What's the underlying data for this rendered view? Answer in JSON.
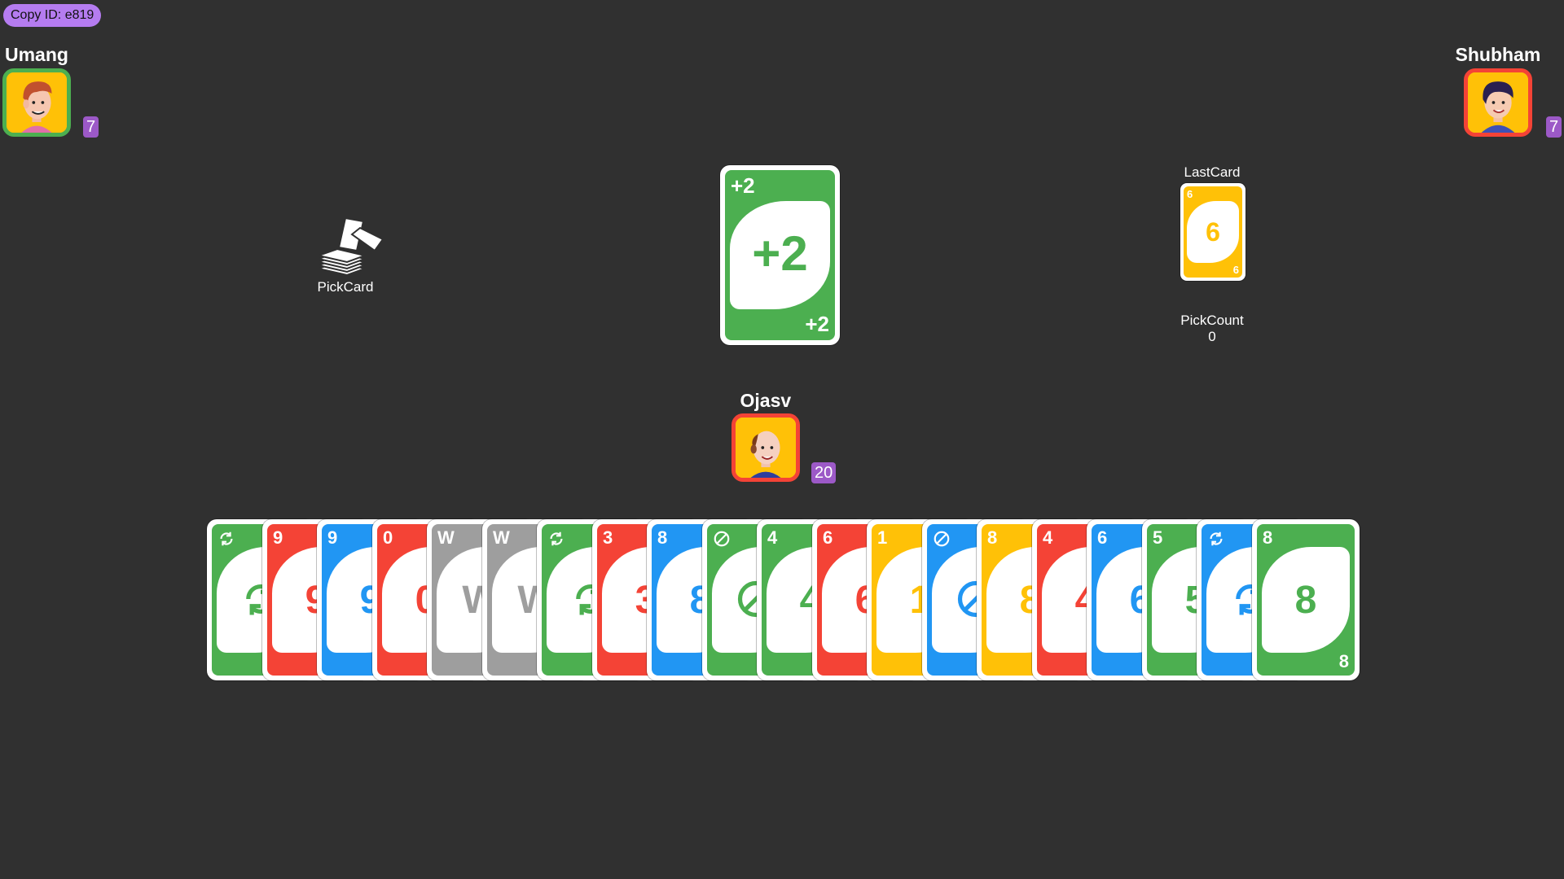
{
  "copy_id": "Copy ID: e819",
  "colors": {
    "green": "#4caf50",
    "red": "#f44336",
    "blue": "#2196f3",
    "yellow": "#ffc107",
    "wild": "#9e9e9e",
    "badge": "#9c59c7",
    "background": "#303030"
  },
  "players": {
    "left": {
      "name": "Umang",
      "count": "7"
    },
    "right": {
      "name": "Shubham",
      "count": "7"
    },
    "self": {
      "name": "Ojasv",
      "count": "20"
    }
  },
  "pick_card": {
    "label": "PickCard"
  },
  "center_card": {
    "color": "green",
    "value": "+2"
  },
  "last_card": {
    "label": "LastCard",
    "color": "yellow",
    "value": "6"
  },
  "pick_count": {
    "label": "PickCount",
    "value": "0"
  },
  "hand": [
    {
      "color": "green",
      "value": "reverse"
    },
    {
      "color": "red",
      "value": "9"
    },
    {
      "color": "blue",
      "value": "9"
    },
    {
      "color": "red",
      "value": "0"
    },
    {
      "color": "wild",
      "value": "W"
    },
    {
      "color": "wild",
      "value": "W"
    },
    {
      "color": "green",
      "value": "reverse"
    },
    {
      "color": "red",
      "value": "3"
    },
    {
      "color": "blue",
      "value": "8"
    },
    {
      "color": "green",
      "value": "skip"
    },
    {
      "color": "green",
      "value": "4"
    },
    {
      "color": "red",
      "value": "6"
    },
    {
      "color": "yellow",
      "value": "1"
    },
    {
      "color": "blue",
      "value": "skip"
    },
    {
      "color": "yellow",
      "value": "8"
    },
    {
      "color": "red",
      "value": "4"
    },
    {
      "color": "blue",
      "value": "6"
    },
    {
      "color": "green",
      "value": "5"
    },
    {
      "color": "blue",
      "value": "reverse"
    },
    {
      "color": "green",
      "value": "8"
    }
  ]
}
